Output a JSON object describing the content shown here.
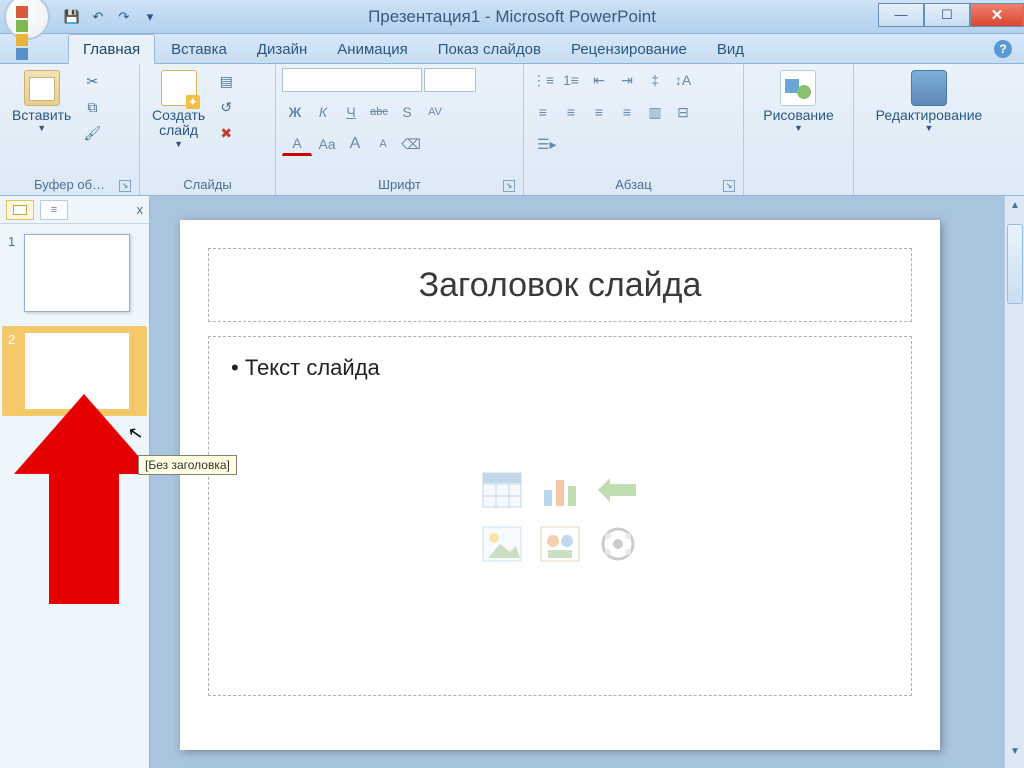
{
  "window": {
    "title": "Презентация1 - Microsoft PowerPoint"
  },
  "qat": {
    "save": "💾",
    "undo": "↶",
    "redo": "↷",
    "more": "▾"
  },
  "tabs": {
    "home": "Главная",
    "insert": "Вставка",
    "design": "Дизайн",
    "animation": "Анимация",
    "slideshow": "Показ слайдов",
    "review": "Рецензирование",
    "view": "Вид"
  },
  "ribbon": {
    "clipboard": {
      "paste": "Вставить",
      "label": "Буфер об…"
    },
    "slides": {
      "new_slide": "Создать\nслайд",
      "label": "Слайды"
    },
    "font": {
      "label": "Шрифт",
      "bold": "Ж",
      "italic": "К",
      "underline": "Ч",
      "strike": "abc",
      "shadow": "S",
      "spacing": "AV",
      "case": "Aa",
      "grow": "A",
      "shrink": "A"
    },
    "paragraph": {
      "label": "Абзац"
    },
    "drawing": {
      "label": "Рисование"
    },
    "editing": {
      "label": "Редактирование"
    }
  },
  "sidebar": {
    "close": "x",
    "slide1_num": "1",
    "slide2_num": "2",
    "tooltip": "[Без заголовка]"
  },
  "slide": {
    "title": "Заголовок слайда",
    "body_text": "Текст слайда"
  },
  "colors": {
    "accent": "#f4c96a",
    "red_arrow": "#e60000"
  }
}
